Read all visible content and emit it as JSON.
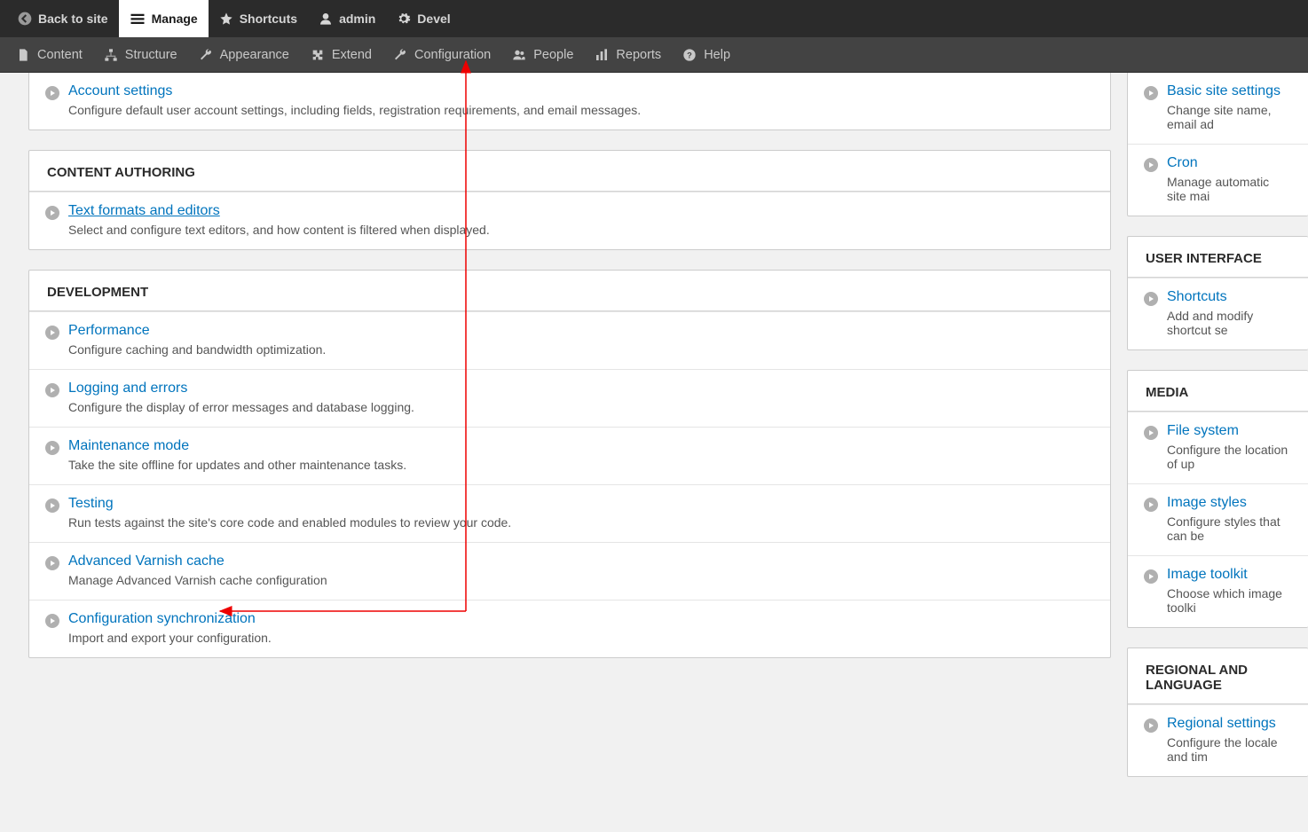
{
  "toolbarTop": {
    "back": "Back to site",
    "manage": "Manage",
    "shortcuts": "Shortcuts",
    "user": "admin",
    "devel": "Devel"
  },
  "toolbarSub": {
    "content": "Content",
    "structure": "Structure",
    "appearance": "Appearance",
    "extend": "Extend",
    "configuration": "Configuration",
    "people": "People",
    "reports": "Reports",
    "help": "Help"
  },
  "main": {
    "people": {
      "items": [
        {
          "title": "Account settings",
          "desc": "Configure default user account settings, including fields, registration requirements, and email messages."
        }
      ]
    },
    "contentAuthoring": {
      "heading": "CONTENT AUTHORING",
      "items": [
        {
          "title": "Text formats and editors",
          "desc": "Select and configure text editors, and how content is filtered when displayed."
        }
      ]
    },
    "development": {
      "heading": "DEVELOPMENT",
      "items": [
        {
          "title": "Performance",
          "desc": "Configure caching and bandwidth optimization."
        },
        {
          "title": "Logging and errors",
          "desc": "Configure the display of error messages and database logging."
        },
        {
          "title": "Maintenance mode",
          "desc": "Take the site offline for updates and other maintenance tasks."
        },
        {
          "title": "Testing",
          "desc": "Run tests against the site's core code and enabled modules to review your code."
        },
        {
          "title": "Advanced Varnish cache",
          "desc": "Manage Advanced Varnish cache configuration"
        },
        {
          "title": "Configuration synchronization",
          "desc": "Import and export your configuration."
        }
      ]
    }
  },
  "side": {
    "system": {
      "items": [
        {
          "title": "Basic site settings",
          "desc": "Change site name, email ad"
        },
        {
          "title": "Cron",
          "desc": "Manage automatic site mai"
        }
      ]
    },
    "userInterface": {
      "heading": "USER INTERFACE",
      "items": [
        {
          "title": "Shortcuts",
          "desc": "Add and modify shortcut se"
        }
      ]
    },
    "media": {
      "heading": "MEDIA",
      "items": [
        {
          "title": "File system",
          "desc": "Configure the location of up"
        },
        {
          "title": "Image styles",
          "desc": "Configure styles that can be"
        },
        {
          "title": "Image toolkit",
          "desc": "Choose which image toolki"
        }
      ]
    },
    "regional": {
      "heading": "REGIONAL AND LANGUAGE",
      "items": [
        {
          "title": "Regional settings",
          "desc": "Configure the locale and tim"
        }
      ]
    }
  }
}
